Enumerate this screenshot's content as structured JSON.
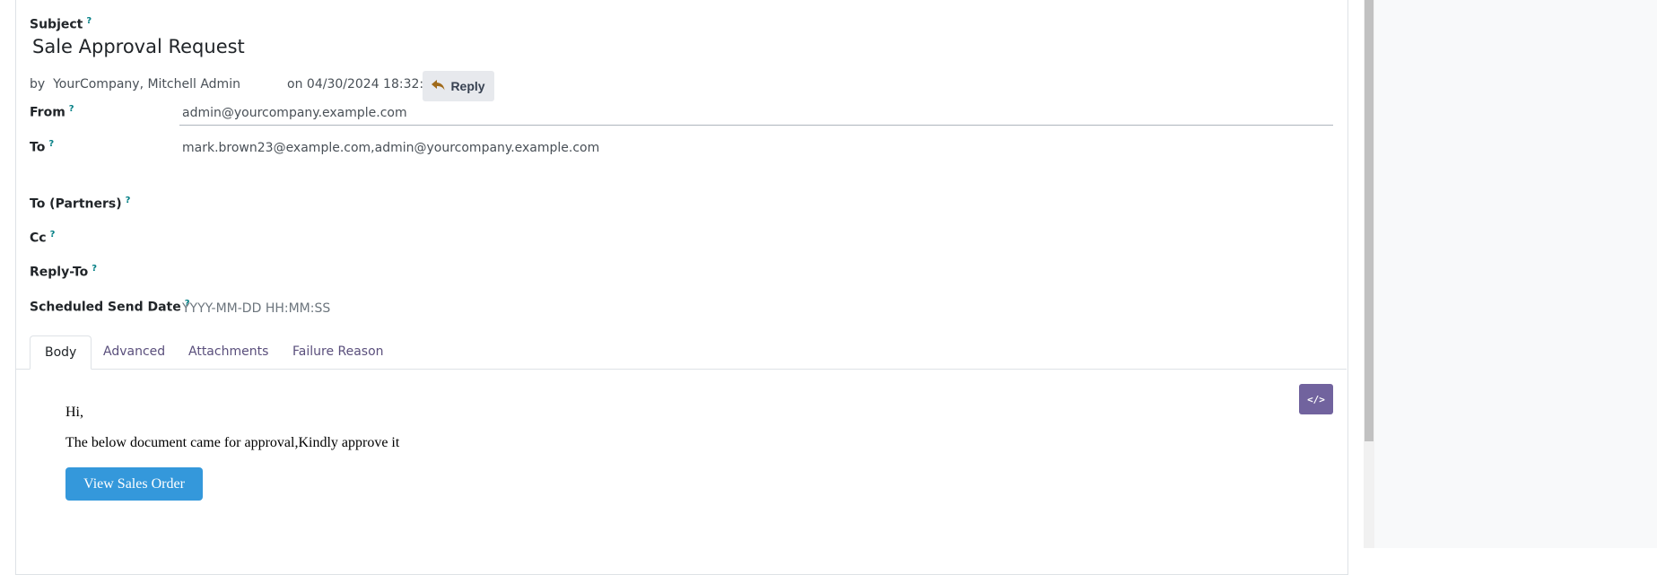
{
  "header": {
    "subject_label": "Subject",
    "help_mark": "?",
    "title": "Sale Approval Request",
    "by_prefix": "by",
    "author": "YourCompany, Mitchell Admin",
    "date_prefix": "on",
    "date": "04/30/2024 18:32:34",
    "reply_label": "Reply",
    "reply_icon": "reply-arrow-icon"
  },
  "fields": {
    "from_label": "From",
    "from_value": "admin@yourcompany.example.com",
    "to_label": "To",
    "to_value": "mark.brown23@example.com,admin@yourcompany.example.com",
    "to_partners_label": "To (Partners)",
    "cc_label": "Cc",
    "reply_to_label": "Reply-To",
    "scheduled_label": "Scheduled Send Date",
    "scheduled_placeholder": "YYYY-MM-DD HH:MM:SS"
  },
  "tabs": [
    {
      "label": "Body",
      "active": true
    },
    {
      "label": "Advanced",
      "active": false
    },
    {
      "label": "Attachments",
      "active": false
    },
    {
      "label": "Failure Reason",
      "active": false
    }
  ],
  "body": {
    "code_view_icon": "</>",
    "greeting": "Hi,",
    "message": "The below document came for approval,Kindly approve it",
    "button_label": "View Sales Order"
  },
  "colors": {
    "accent_purple": "#71639e",
    "help_teal": "#017e84",
    "body_button_blue": "#3498db"
  }
}
